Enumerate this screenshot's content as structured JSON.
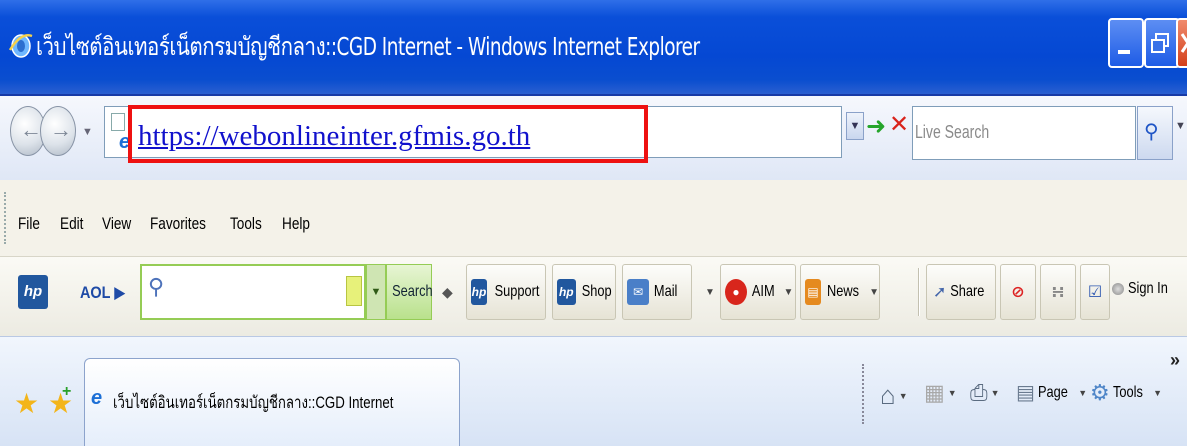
{
  "window": {
    "title": "เว็บไซต์อินเทอร์เน็ตกรมบัญชีกลาง::CGD Internet - Windows Internet Explorer"
  },
  "address_bar": {
    "url": "https://webonlineinter.gfmis.go.th",
    "search_placeholder": "Live Search"
  },
  "menu": {
    "items": [
      "File",
      "Edit",
      "View",
      "Favorites",
      "Tools",
      "Help"
    ]
  },
  "toolbar": {
    "aol_label": "AOL",
    "search_label": "Search",
    "buttons": [
      "Support",
      "Shop",
      "Mail",
      "AIM",
      "News"
    ],
    "share_label": "Share",
    "signin_label": "Sign In"
  },
  "tabs": {
    "active_tab_label": "เว็บไซต์อินเทอร์เน็ตกรมบัญชีกลาง::CGD Internet"
  },
  "commands": {
    "page_label": "Page",
    "tools_label": "Tools",
    "more_label": "»"
  },
  "colors": {
    "title_bar": "#0548d3",
    "highlight_box": "#ee1111",
    "url_link": "#1111cc",
    "aol_green": "#95cc55"
  }
}
